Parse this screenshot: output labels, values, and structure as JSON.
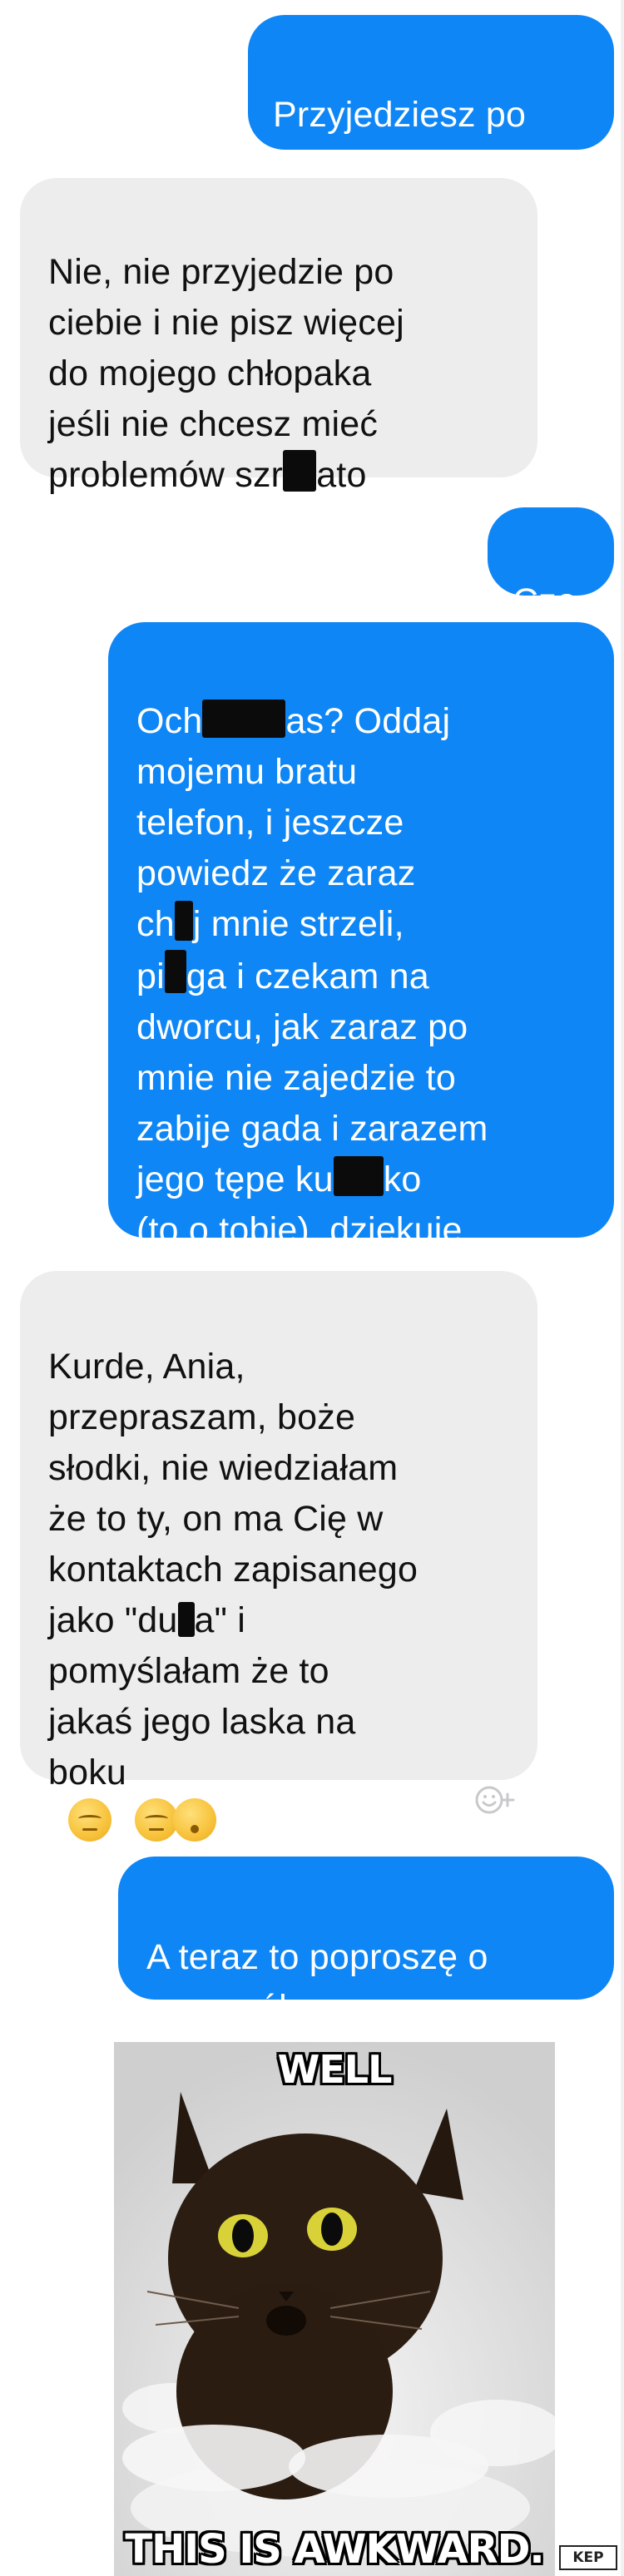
{
  "messages": [
    {
      "id": "m1",
      "side": "out",
      "text": "Przyjedziesz po\nmnie?"
    },
    {
      "id": "m2",
      "side": "in",
      "parts": [
        "Nie, nie przyjedzie po\nciebie i nie pisz więcej\ndo mojego chłopaka\njeśli nie chcesz mieć\nproblemów szr",
        "ato"
      ]
    },
    {
      "id": "m3",
      "side": "out",
      "text": "Czo"
    },
    {
      "id": "m4",
      "side": "out",
      "parts": [
        "Och",
        "as? Oddaj\nmojemu bratu\ntelefon, i jeszcze\npowiedz że zaraz\nch",
        "j mnie strzeli,\npi",
        "ga i czekam na\ndworcu, jak zaraz po\nmnie nie zajedzie to\nzabije gada i zarazem\njego tępe ku",
        "ko\n(to o tobie), dziękuję."
      ]
    },
    {
      "id": "m5",
      "side": "in",
      "parts": [
        "Kurde, Ania,\nprzepraszam, boże\nsłodki, nie wiedziałam\nże to ty, on ma Cię w\nkontaktach zapisanego\njako \"du",
        "a\" i\npomyślałam że to\njakaś jego laska na\nboku"
      ]
    },
    {
      "id": "m6",
      "side": "out",
      "text": "A teraz to poproszę o\nszczegóły"
    }
  ],
  "emojis": [
    "pensive-face",
    "pensive-face",
    "dizzy-face"
  ],
  "meme": {
    "top_text": "WELL",
    "bottom_text": "THIS IS AWKWARD."
  },
  "watermark": "KEP",
  "colors": {
    "outgoing_bubble": "#0f86f5",
    "incoming_bubble": "#ededee"
  }
}
